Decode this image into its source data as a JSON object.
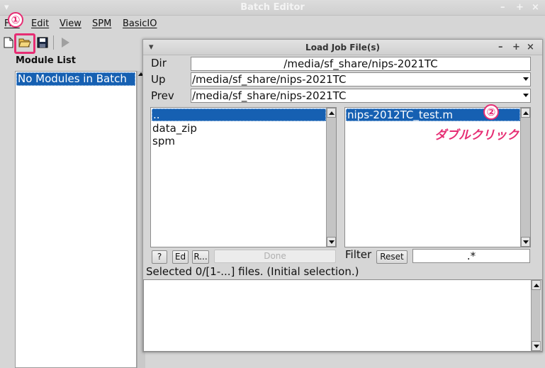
{
  "window": {
    "title": "Batch Editor",
    "controls": [
      "▾",
      "–",
      "+",
      "×"
    ]
  },
  "menubar": [
    "File",
    "Edit",
    "View",
    "SPM",
    "BasicIO"
  ],
  "module_list": {
    "label": "Module List",
    "items": [
      "No Modules in Batch"
    ]
  },
  "dialog": {
    "title": "Load Job File(s)",
    "controls": [
      "▾",
      "–",
      "+",
      "×"
    ],
    "dir_label": "Dir",
    "dir_value": "/media/sf_share/nips-2021TC",
    "up_label": "Up",
    "up_value": "/media/sf_share/nips-2021TC",
    "prev_label": "Prev",
    "prev_value": "/media/sf_share/nips-2021TC",
    "dirs": [
      "..",
      "data_zip",
      "spm"
    ],
    "files": [
      "nips-2012TC_test.m"
    ],
    "buttons": {
      "help": "?",
      "edit": "Ed",
      "rec": "R...",
      "done": "Done",
      "reset": "Reset"
    },
    "filter_label": "Filter",
    "filter_value": ".*",
    "status": "Selected 0/[1-...] files. (Initial selection.)"
  },
  "annotations": {
    "step1": "①",
    "step2": "②",
    "step2_text": "ダブルクリック",
    "color": "#e62d73"
  },
  "colors": {
    "selection": "#1660b2",
    "accent": "#e62d73"
  }
}
